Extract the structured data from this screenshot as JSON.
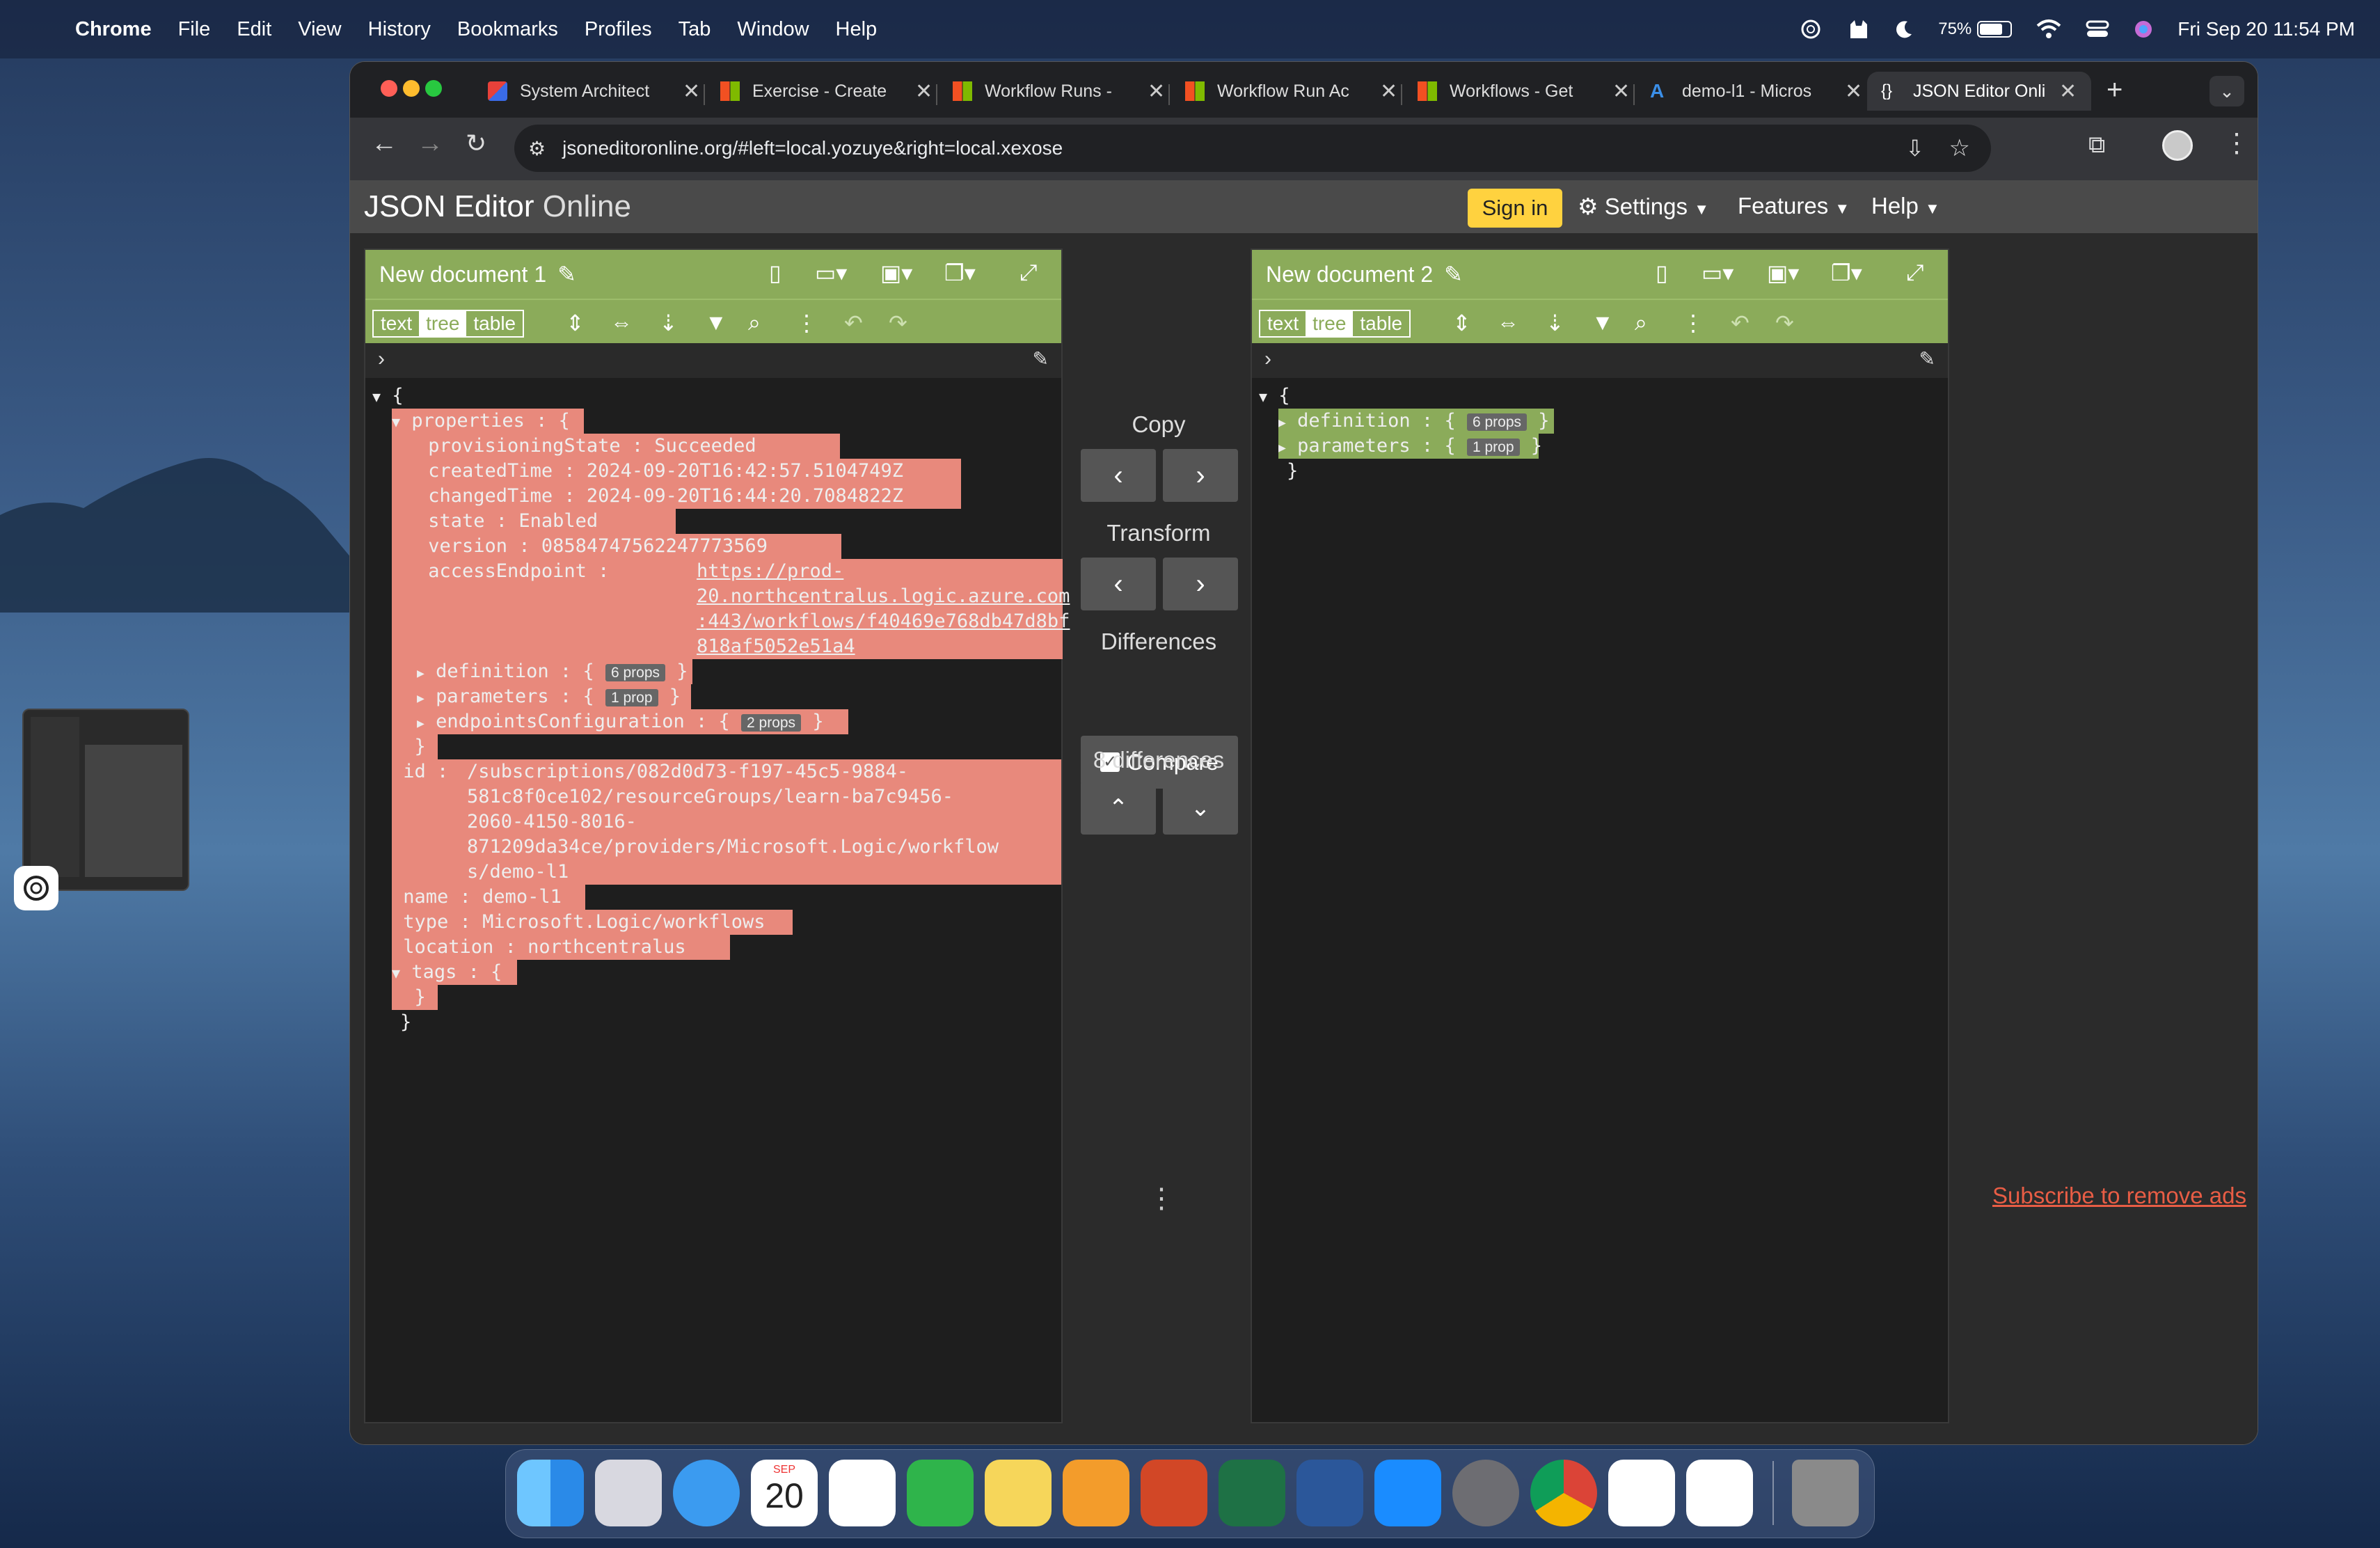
{
  "menubar": {
    "app": "Chrome",
    "items": [
      "File",
      "Edit",
      "View",
      "History",
      "Bookmarks",
      "Profiles",
      "Tab",
      "Window",
      "Help"
    ],
    "battery": "75%",
    "datetime": "Fri Sep 20  11:54 PM"
  },
  "browser": {
    "tabs": [
      {
        "title": "System Architect"
      },
      {
        "title": "Exercise - Create"
      },
      {
        "title": "Workflow Runs -"
      },
      {
        "title": "Workflow Run Ac"
      },
      {
        "title": "Workflows - Get"
      },
      {
        "title": "demo-l1 - Micros"
      },
      {
        "title": "JSON Editor Onli"
      }
    ],
    "new_tab": "+",
    "url": "jsoneditoronline.org/#left=local.yozuye&right=local.xexose"
  },
  "app": {
    "title_bold": "JSON Editor",
    "title_light": "Online",
    "sign_in": "Sign in",
    "settings": "Settings",
    "features": "Features",
    "help": "Help",
    "subscribe": "Subscribe to remove ads"
  },
  "left": {
    "doc_title": "New document 1",
    "modes": [
      "text",
      "tree",
      "table"
    ],
    "lines": {
      "l0": "{",
      "properties_key": "properties",
      "properties_brace": "{",
      "ps_key": "provisioningState",
      "ps_val": "Succeeded",
      "ct_key": "createdTime",
      "ct_val": "2024-09-20T16:42:57.5104749Z",
      "cht_key": "changedTime",
      "cht_val": "2024-09-20T16:44:20.7084822Z",
      "state_key": "state",
      "state_val": "Enabled",
      "ver_key": "version",
      "ver_val": "08584747562247773569",
      "ae_key": "accessEndpoint",
      "ae_val1": "https://prod-",
      "ae_val2": "20.northcentralus.logic.azure.com",
      "ae_val3": ":443/workflows/f40469e768db47d8bf",
      "ae_val4": "818af5052e51a4",
      "def_key": "definition",
      "def_badge": "6 props",
      "par_key": "parameters",
      "par_badge": "1 prop",
      "ec_key": "endpointsConfiguration",
      "ec_badge": "2 props",
      "close_props": "}",
      "id_key": "id",
      "id_val1": "/subscriptions/082d0d73-f197-45c5-9884-",
      "id_val2": "581c8f0ce102/resourceGroups/learn-ba7c9456-",
      "id_val3": "2060-4150-8016-",
      "id_val4": "871209da34ce/providers/Microsoft.Logic/workflow",
      "id_val5": "s/demo-l1",
      "name_key": "name",
      "name_val": "demo-l1",
      "type_key": "type",
      "type_val": "Microsoft.Logic/workflows",
      "loc_key": "location",
      "loc_val": "northcentralus",
      "tags_key": "tags",
      "tags_open": "{",
      "tags_close": "}",
      "l_end": "}"
    }
  },
  "right": {
    "doc_title": "New document 2",
    "modes": [
      "text",
      "tree",
      "table"
    ],
    "lines": {
      "open": "{",
      "def_key": "definition",
      "def_badge": "6 props",
      "par_key": "parameters",
      "par_badge": "1 prop",
      "close": "}"
    }
  },
  "middle": {
    "copy": "Copy",
    "transform": "Transform",
    "differences": "Differences",
    "compare": "Compare",
    "diff_count": "8 differences"
  },
  "dock": {
    "calendar_month": "SEP",
    "calendar_day": "20"
  }
}
